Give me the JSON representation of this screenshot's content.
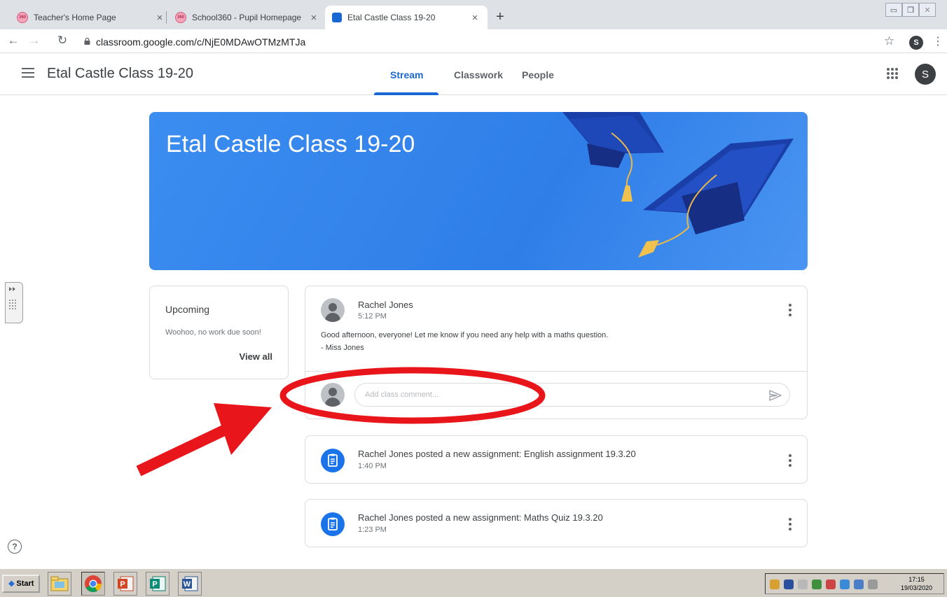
{
  "browser": {
    "tabs": [
      {
        "title": "Teacher's Home Page",
        "close": "×"
      },
      {
        "title": "School360 - Pupil Homepage",
        "close": "×"
      },
      {
        "title": "Etal Castle Class 19-20",
        "close": "×"
      }
    ],
    "new_tab": "+",
    "url": "classroom.google.com/c/NjE0MDAwOTMzMTJa",
    "profile_initial": "S"
  },
  "header": {
    "title": "Etal Castle Class 19-20",
    "tabs": [
      "Stream",
      "Classwork",
      "People"
    ],
    "active_tab": "Stream",
    "avatar_initial": "S"
  },
  "banner": {
    "title": "Etal Castle Class 19-20"
  },
  "upcoming": {
    "heading": "Upcoming",
    "message": "Woohoo, no work due soon!",
    "view_all": "View all"
  },
  "post": {
    "author": "Rachel Jones",
    "time": "5:12 PM",
    "message_line1": "Good afternoon, everyone! Let me know if you need any help with a maths question.",
    "message_line2": "- Miss Jones",
    "comment_placeholder": "Add class comment..."
  },
  "assignments": [
    {
      "title": "Rachel Jones posted a new assignment: English assignment 19.3.20",
      "time": "1:40 PM"
    },
    {
      "title": "Rachel Jones posted a new assignment: Maths Quiz 19.3.20",
      "time": "1:23 PM"
    }
  ],
  "help_glyph": "?",
  "taskbar": {
    "start_label": "Start",
    "clock_time": "17:15",
    "clock_date": "19/03/2020"
  },
  "colors": {
    "accent": "#1967d2",
    "annotation": "#e8151b",
    "banner": "#3b8df0"
  },
  "icons": [
    "back-icon",
    "forward-icon",
    "reload-icon",
    "lock-icon",
    "star-icon",
    "menu-icon",
    "apps-grid-icon",
    "send-icon",
    "assignment-icon",
    "more-vert-icon",
    "help-icon"
  ]
}
